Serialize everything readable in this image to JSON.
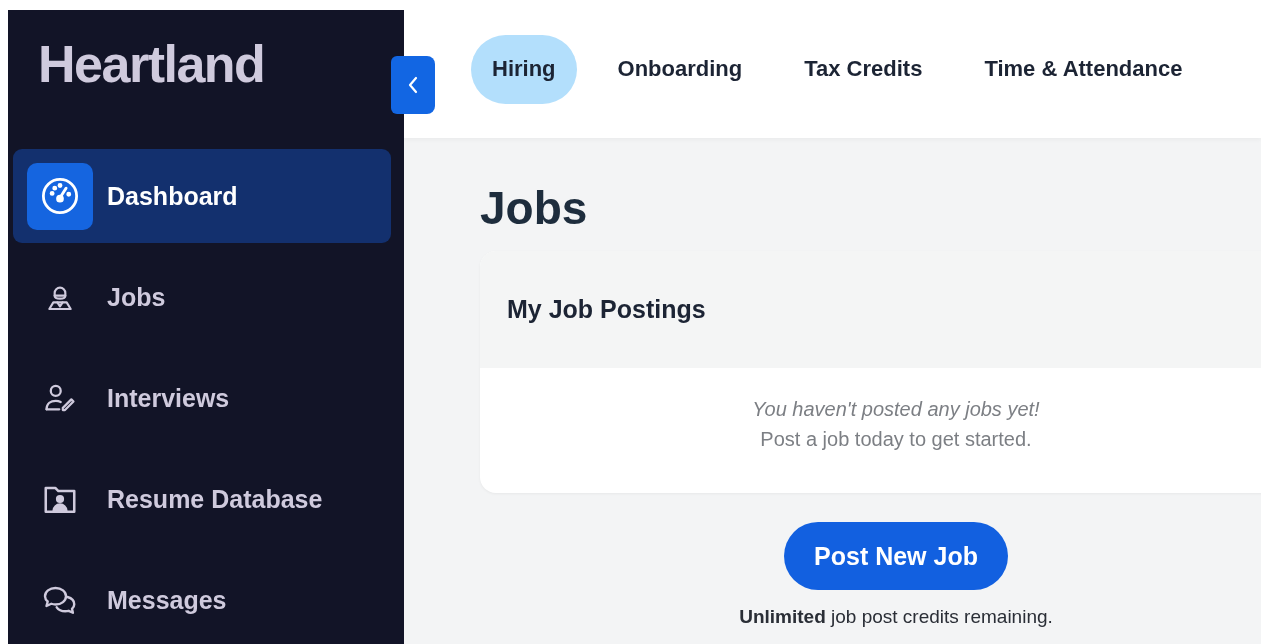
{
  "brand": {
    "name": "Heartland"
  },
  "sidebar": {
    "items": [
      {
        "label": "Dashboard",
        "selected": true
      },
      {
        "label": "Jobs",
        "selected": false
      },
      {
        "label": "Interviews",
        "selected": false
      },
      {
        "label": "Resume Database",
        "selected": false
      },
      {
        "label": "Messages",
        "selected": false
      }
    ]
  },
  "top_nav": {
    "tabs": [
      {
        "label": "Hiring",
        "selected": true
      },
      {
        "label": "Onboarding",
        "selected": false
      },
      {
        "label": "Tax Credits",
        "selected": false
      },
      {
        "label": "Time & Attendance",
        "selected": false
      }
    ]
  },
  "page": {
    "title": "Jobs"
  },
  "card": {
    "title": "My Job Postings",
    "empty_message": "You haven't posted any jobs yet!",
    "empty_hint": "Post a job today to get started."
  },
  "primary_button": {
    "label": "Post New Job"
  },
  "credits_note": "**Unlimited** job post credits remaining."
}
